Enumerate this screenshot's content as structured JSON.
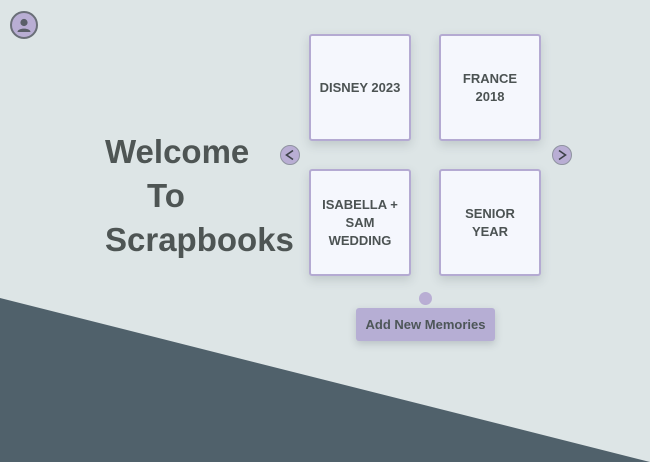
{
  "welcome": {
    "line1": "Welcome",
    "line2": "To",
    "line3": "Scrapbooks"
  },
  "scrapbooks": [
    {
      "title": "DISNEY 2023"
    },
    {
      "title": "FRANCE 2018"
    },
    {
      "title": "ISABELLA + SAM WEDDING"
    },
    {
      "title": "SENIOR YEAR"
    }
  ],
  "actions": {
    "add_label": "Add New Memories"
  },
  "icons": {
    "profile": "user-avatar-icon",
    "prev": "chevron-left-icon",
    "next": "chevron-right-icon"
  },
  "colors": {
    "background": "#dde5e6",
    "wedge": "#50616b",
    "accent": "#b9aed4",
    "card": "#f5f7fd",
    "text": "#4e5554"
  }
}
